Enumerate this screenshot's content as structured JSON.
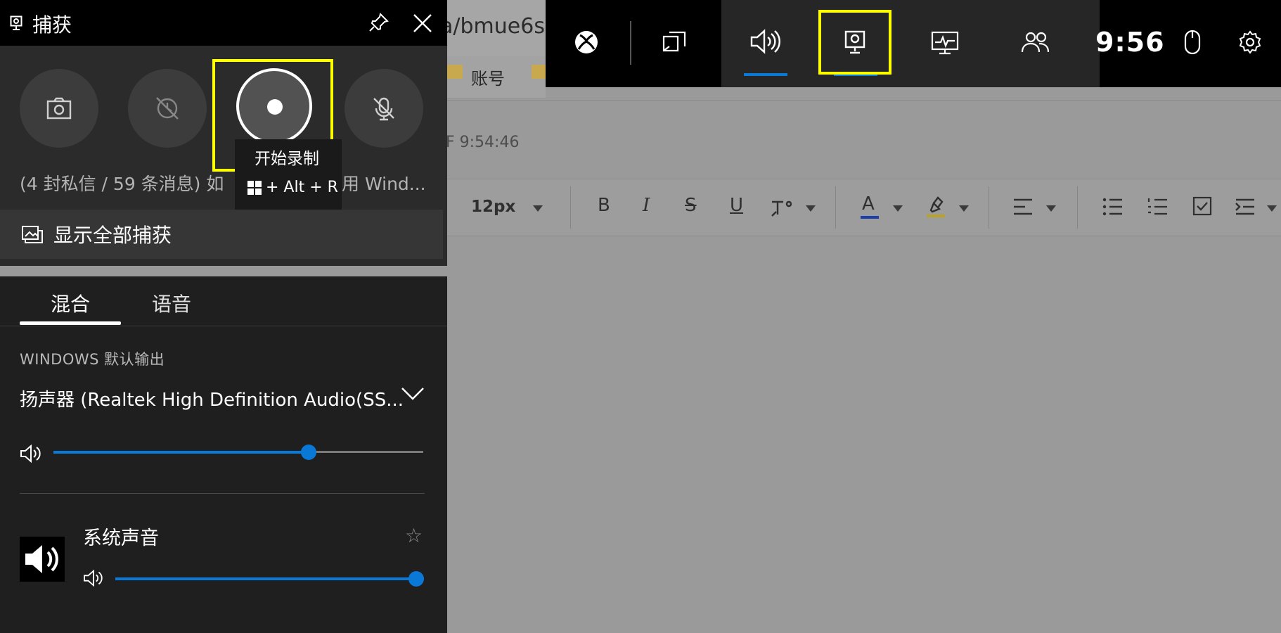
{
  "browser": {
    "url_fragment": "a/bmue6s",
    "bookmark": "账号",
    "timestamp": "F 9:54:46",
    "editor_toolbar": {
      "font_size": "12px",
      "bold": "B",
      "italic": "I",
      "strike": "S",
      "underline": "U",
      "text_color_letter": "A"
    }
  },
  "capture": {
    "title": "捕获",
    "tooltip_title": "开始录制",
    "tooltip_shortcut": "+ Alt + R",
    "info_left": "(4 封私信 / 59 条消息) 如",
    "info_right": "用 Wind...",
    "show_all": "显示全部捕获",
    "icons": {
      "header": "capture-widget-icon",
      "pin": "pin-icon",
      "close": "close-icon",
      "screenshot": "camera-icon",
      "record_last": "record-last-disabled-icon",
      "record": "record-icon",
      "mic": "mic-off-icon",
      "gallery": "gallery-icon"
    }
  },
  "audio": {
    "tabs": [
      "混合",
      "语音"
    ],
    "active_tab": "混合",
    "section_label": "WINDOWS 默认输出",
    "device": "扬声器 (Realtek High Definition Audio(SS...",
    "master_volume": 0.69,
    "app_name": "系统声音",
    "app_volume": 1.0,
    "star": "☆"
  },
  "gamebar": {
    "time": "9:56",
    "icons": [
      "xbox-icon",
      "widget-menu-icon",
      "audio-icon",
      "capture-icon",
      "performance-icon",
      "social-icon",
      "mouse-icon",
      "settings-icon"
    ],
    "accent": "#0a78d6",
    "highlight": "#ffff00"
  }
}
